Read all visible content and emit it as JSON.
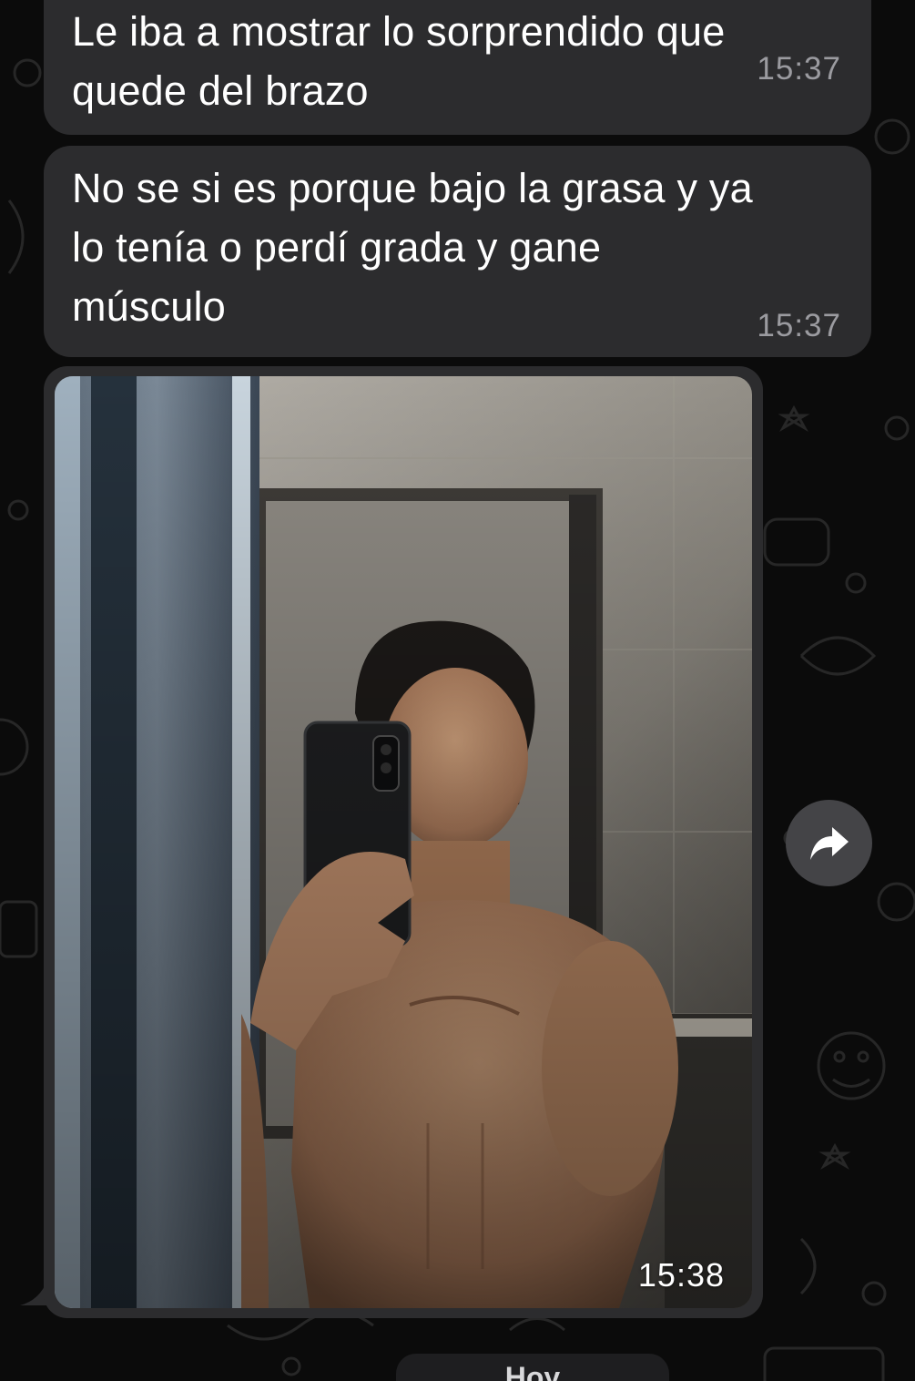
{
  "messages": [
    {
      "text": "Le iba a mostrar lo sorprendido que\nquede del brazo",
      "time": "15:37"
    },
    {
      "text": "No se si es porque bajo la grasa y ya\nlo tenía o perdí grada y gane\nmúsculo",
      "time": "15:37"
    },
    {
      "type": "photo",
      "time": "15:38"
    }
  ],
  "forward_button": {
    "icon": "forward-arrow-icon"
  },
  "date_separator": {
    "label": "Hoy"
  },
  "colors": {
    "background": "#0b0b0b",
    "bubble": "#2c2c2e",
    "text": "#ffffff",
    "timestamp": "#9b9ba0"
  }
}
